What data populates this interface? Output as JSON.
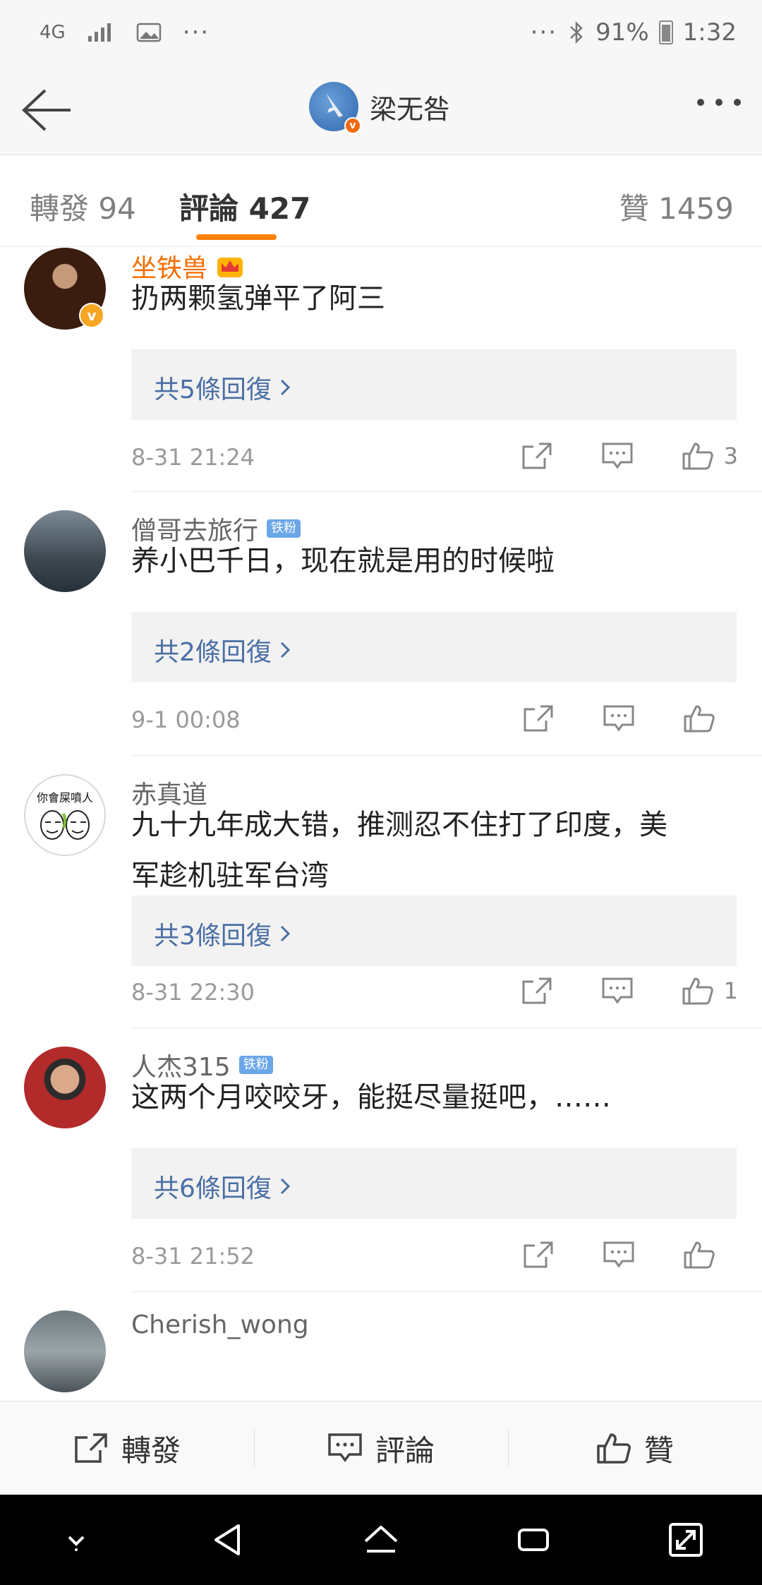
{
  "status_bar": {
    "network": "4G",
    "dots": "···",
    "more_dots": "···",
    "battery": "91%",
    "time": "1:32"
  },
  "nav": {
    "title": "梁无咎",
    "badge": "v"
  },
  "tabs": {
    "repost": "轉發 94",
    "comment": "評論 427",
    "like": "贊 1459"
  },
  "comments": [
    {
      "username": "坐铁兽",
      "vip": true,
      "text": "扔两颗氢弹平了阿三",
      "replies": "共5條回復",
      "time": "8-31 21:24",
      "likes": "3"
    },
    {
      "username": "僧哥去旅行",
      "badge": "铁粉",
      "text": "养小巴千日，现在就是用的时候啦",
      "replies": "共2條回復",
      "time": "9-1 00:08",
      "likes": ""
    },
    {
      "username": "赤真道",
      "avatar_text": "你會屎噴人",
      "text_line1": "九十九年成大错，推测忍不住打了印度，美",
      "text_line2": "军趁机驻军台湾",
      "replies": "共3條回復",
      "time": "8-31 22:30",
      "likes": "1"
    },
    {
      "username": "人杰315",
      "badge": "铁粉",
      "text": "这两个月咬咬牙，能挺尽量挺吧，……",
      "replies": "共6條回復",
      "time": "8-31 21:52",
      "likes": ""
    },
    {
      "username": "Cherish_wong"
    }
  ],
  "bottom_bar": {
    "repost": "轉發",
    "comment": "評論",
    "like": "贊"
  },
  "colors": {
    "accent": "#ff8200",
    "vip_name": "#f86c00",
    "link": "#4a6fa5",
    "fan_badge": "#6ba6e8"
  }
}
